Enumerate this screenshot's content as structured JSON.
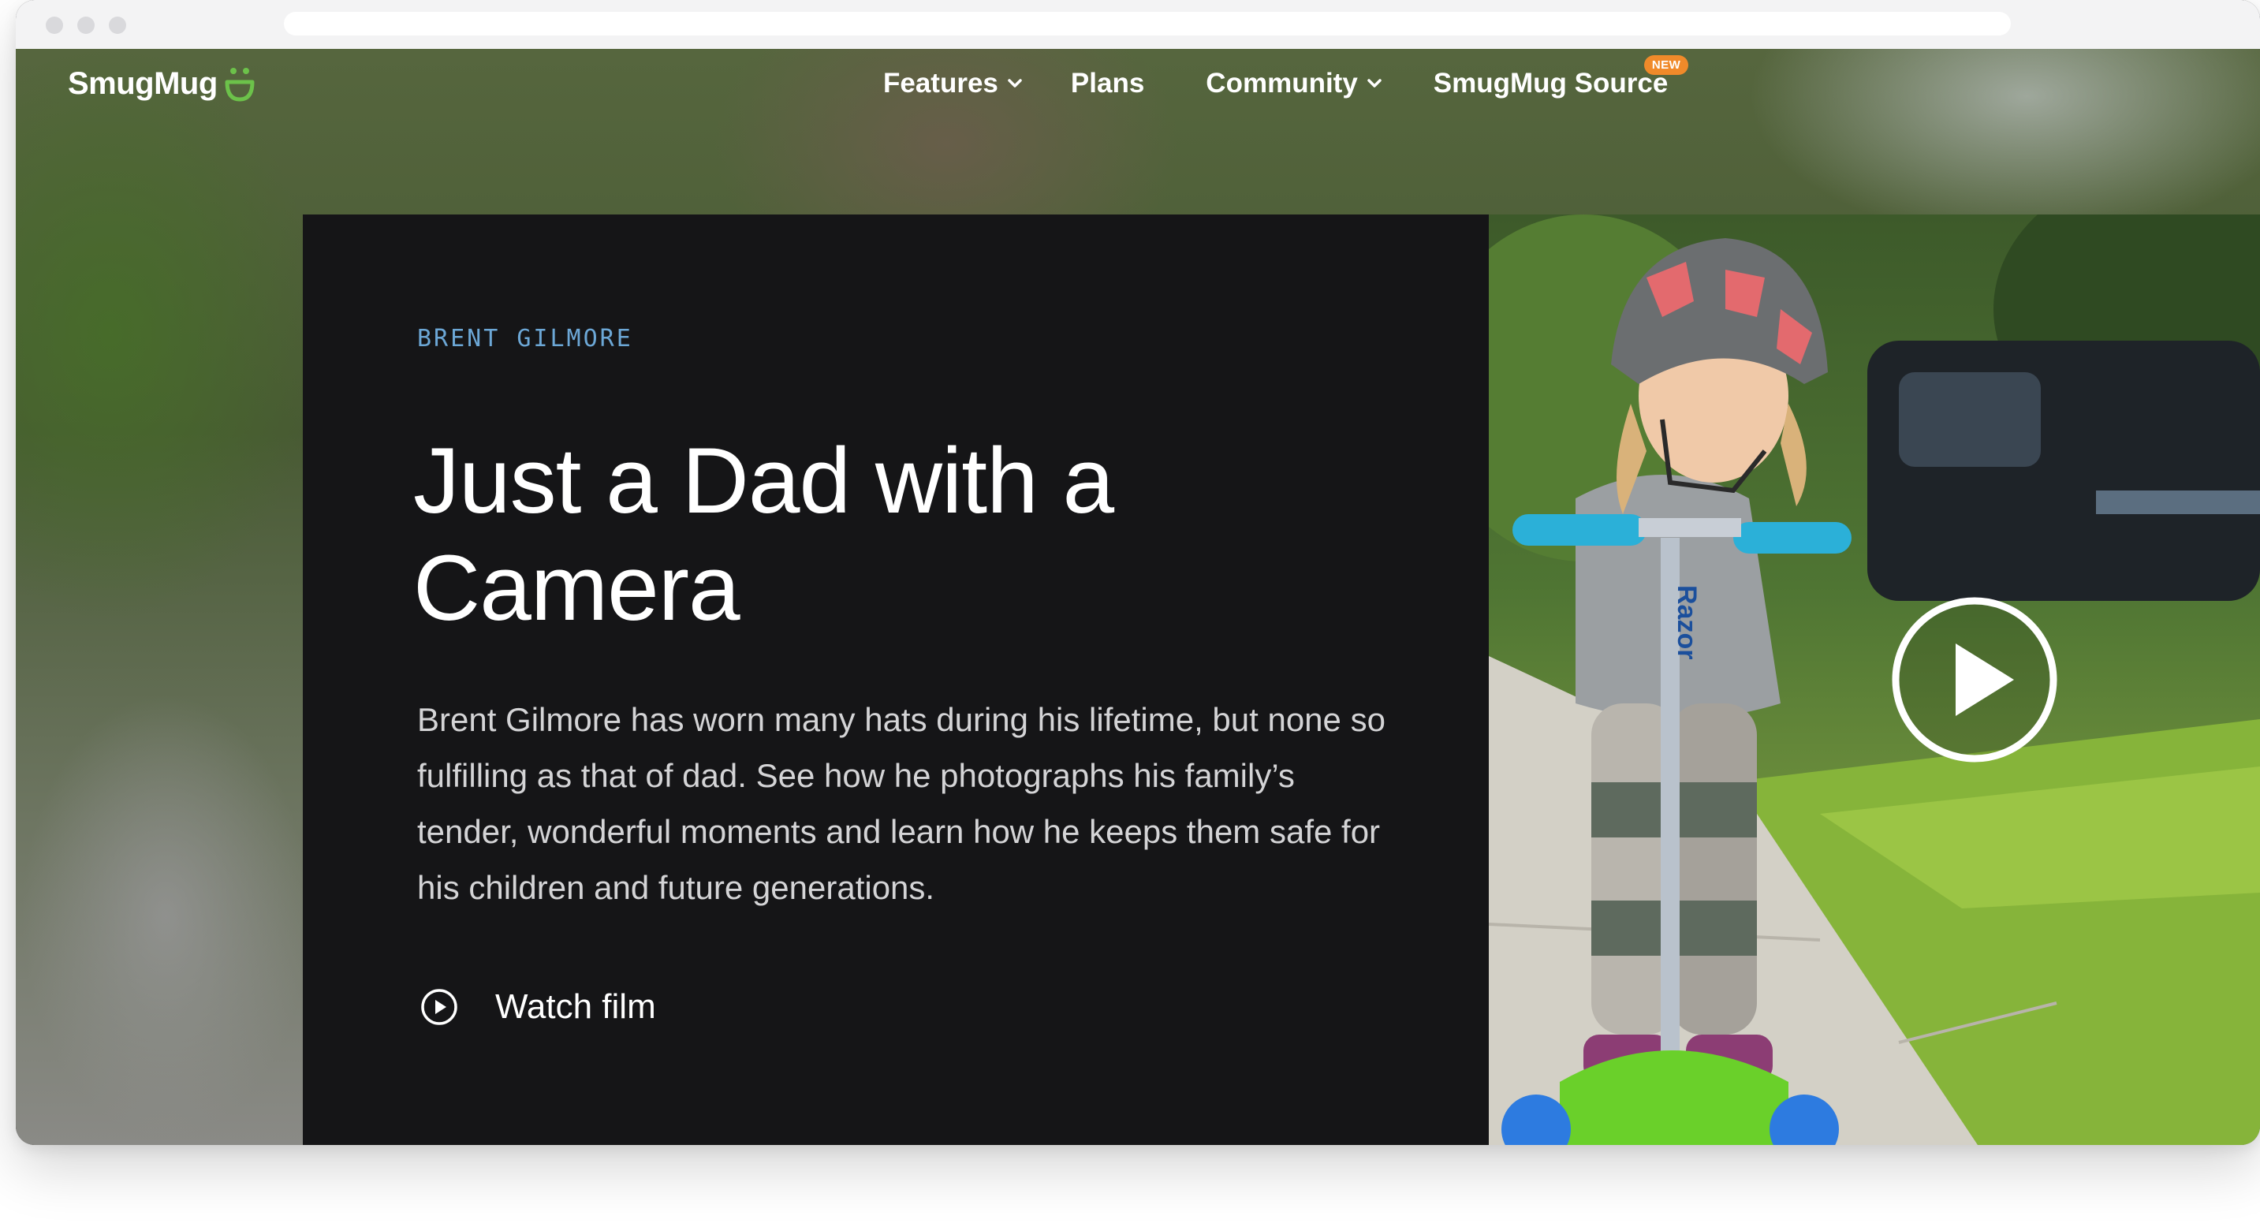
{
  "nav": {
    "logo": "SmugMug",
    "links": [
      {
        "label": "Features",
        "has_dropdown": true
      },
      {
        "label": "Plans",
        "has_dropdown": false
      },
      {
        "label": "Community",
        "has_dropdown": true
      },
      {
        "label": "SmugMug Source",
        "has_dropdown": false,
        "badge": "NEW"
      }
    ]
  },
  "hero": {
    "eyebrow": "BRENT GILMORE",
    "title": "Just a Dad with a Camera",
    "body": "Brent Gilmore has worn many hats during his lifetime, but none so fulfilling as that of dad. See how he photographs his family’s tender, wonderful moments and learn how he keeps them safe for his children and future generations.",
    "cta_label": "Watch film"
  },
  "photo": {
    "scooter_brand": "Razor"
  },
  "colors": {
    "card_bg": "#151517",
    "eyebrow": "#6ca7d6",
    "badge": "#f08a2a",
    "logo_accent": "#6cc24a"
  },
  "icons": {
    "logo_mark": "smiley-icon",
    "dropdown": "chevron-down-icon",
    "cta": "play-circle-icon",
    "video": "play-circle-icon"
  }
}
